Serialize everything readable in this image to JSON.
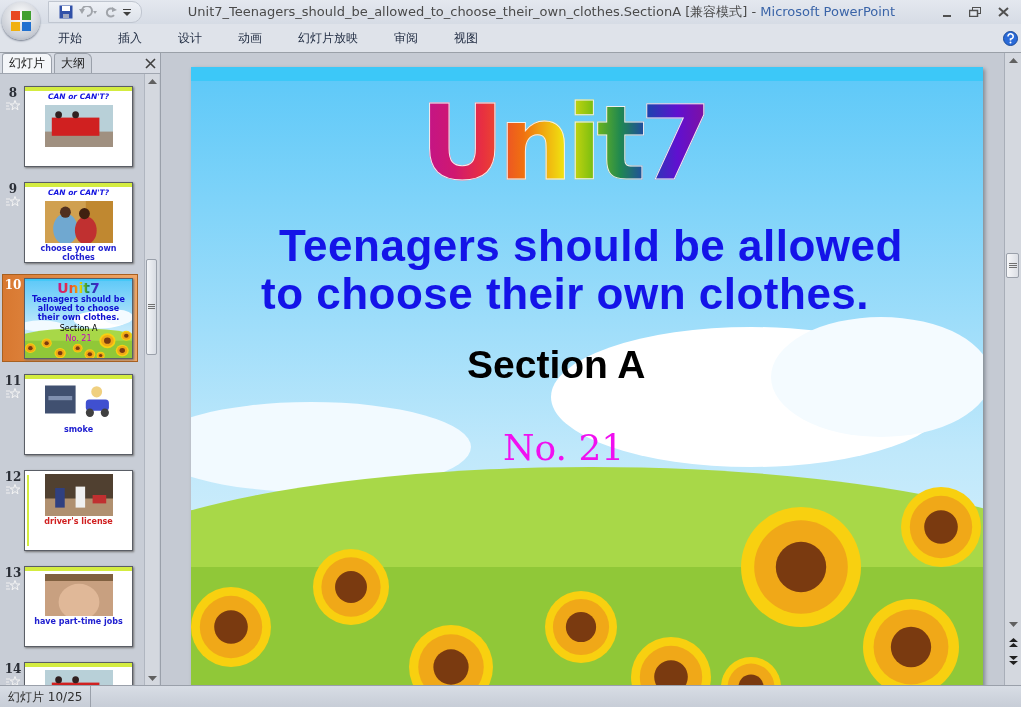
{
  "window": {
    "document_title": "Unit7_Teenagers_should_be_allowed_to_choose_their_own_clothes.SectionA [兼容模式]",
    "separator": "-",
    "app_name": "Microsoft PowerPoint"
  },
  "ribbon_tabs": [
    {
      "label": "开始",
      "selected": false
    },
    {
      "label": "插入",
      "selected": false
    },
    {
      "label": "设计",
      "selected": false
    },
    {
      "label": "动画",
      "selected": false
    },
    {
      "label": "幻灯片放映",
      "selected": false
    },
    {
      "label": "审阅",
      "selected": false
    },
    {
      "label": "视图",
      "selected": false
    }
  ],
  "panel_tabs": [
    {
      "label": "幻灯片",
      "selected": true
    },
    {
      "label": "大纲",
      "selected": false
    }
  ],
  "slides": [
    {
      "number": "8",
      "animated": true,
      "selected": false,
      "kind": "banner_picture",
      "title": "CAN or CAN'T?"
    },
    {
      "number": "9",
      "animated": true,
      "selected": false,
      "kind": "banner_picture",
      "title": "CAN or CAN'T?",
      "caption": "choose your own clothes"
    },
    {
      "number": "10",
      "animated": false,
      "selected": true,
      "kind": "title",
      "title": "Unit7",
      "subtitle": "Teenagers should be allowed to choose their own clothes.",
      "section": "Section A",
      "tag": "No. 21"
    },
    {
      "number": "11",
      "animated": true,
      "selected": false,
      "kind": "banner_picture",
      "caption": "smoke"
    },
    {
      "number": "12",
      "animated": true,
      "selected": false,
      "kind": "side_picture",
      "caption": "driver's license"
    },
    {
      "number": "13",
      "animated": true,
      "selected": false,
      "kind": "banner_picture",
      "caption": "have part-time jobs"
    },
    {
      "number": "14",
      "animated": true,
      "selected": false,
      "kind": "banner_picture"
    }
  ],
  "slide": {
    "title": "Unit7",
    "subtitle_lines": [
      "Teenagers should be allowed",
      "to choose their own clothes."
    ],
    "section": "Section A",
    "number": "No. 21"
  },
  "status_bar": {
    "slide_indicator": "幻灯片 10/25"
  }
}
